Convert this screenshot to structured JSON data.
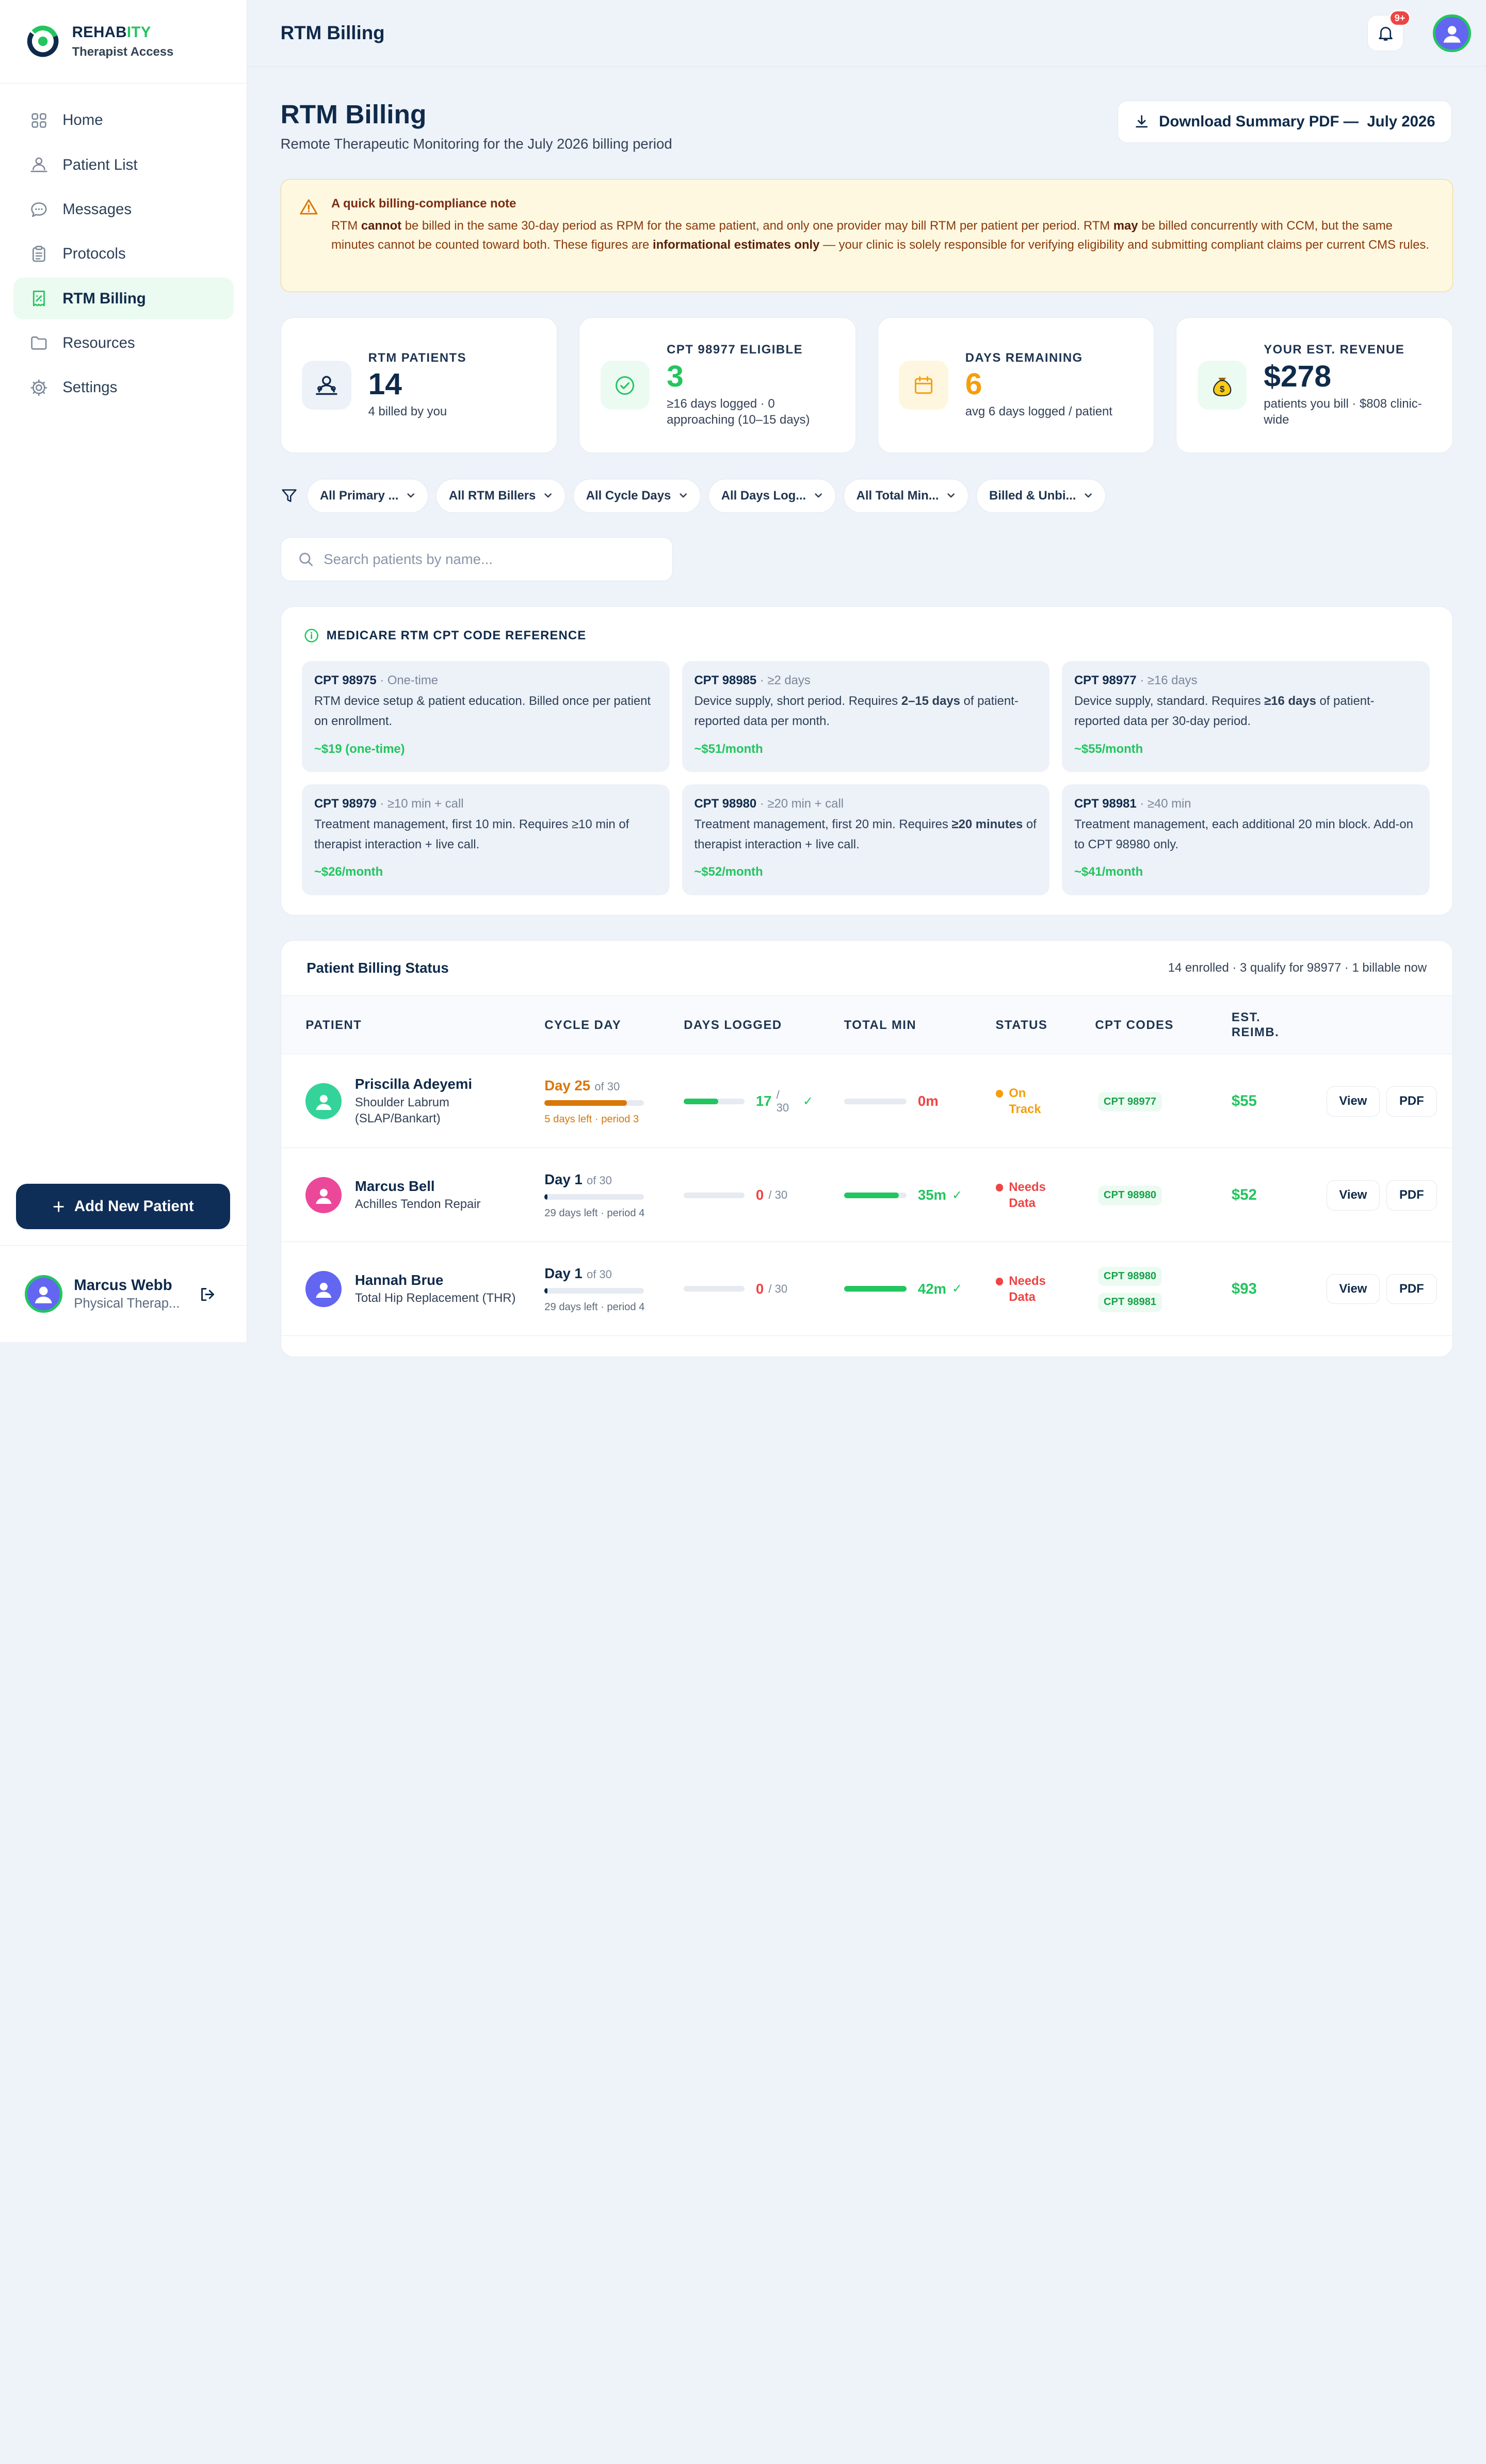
{
  "brand": {
    "name_main": "REHAB",
    "name_accent": "ITY",
    "subtitle": "Therapist Access"
  },
  "sidebar": {
    "items": [
      {
        "label": "Home",
        "icon": "grid-icon"
      },
      {
        "label": "Patient List",
        "icon": "users-icon"
      },
      {
        "label": "Messages",
        "icon": "chat-icon"
      },
      {
        "label": "Protocols",
        "icon": "clipboard-icon"
      },
      {
        "label": "RTM Billing",
        "icon": "receipt-icon",
        "active": true
      },
      {
        "label": "Resources",
        "icon": "folder-icon"
      },
      {
        "label": "Settings",
        "icon": "gear-icon"
      }
    ],
    "add_button": "Add New Patient",
    "user": {
      "name": "Marcus Webb",
      "role": "Physical Therap..."
    }
  },
  "topbar": {
    "title": "RTM Billing",
    "notifications": "9+"
  },
  "header": {
    "title": "RTM Billing",
    "subtitle": "Remote Therapeutic Monitoring for the July 2026 billing period",
    "download_label": "Download Summary PDF —  July 2026"
  },
  "note": {
    "title": "A quick billing-compliance note",
    "t1": "RTM ",
    "b1": "cannot",
    "t2": " be billed in the same 30-day period as RPM for the same patient, and only one provider may bill RTM per patient per period. RTM ",
    "b2": "may",
    "t3": " be billed concurrently with CCM, but the same minutes cannot be counted toward both. These figures are ",
    "b3": "informational estimates only",
    "t4": " — your clinic is solely responsible for verifying eligibility and submitting compliant claims per current CMS rules."
  },
  "stats": [
    {
      "label": "RTM Patients",
      "value": "14",
      "sub": "4 billed by you",
      "color": "#0f2a4a",
      "icon": "users-icon",
      "bg": "#edf1f8"
    },
    {
      "label": "CPT 98977 Eligible",
      "value": "3",
      "sub": "≥16 days logged · 0 approaching (10–15 days)",
      "color": "#22c55e",
      "icon": "check-circle-icon",
      "bg": "#ecfbf1"
    },
    {
      "label": "Days Remaining",
      "value": "6",
      "sub": "avg 6 days logged / patient",
      "color": "#f59e0b",
      "icon": "calendar-icon",
      "bg": "#fff6e0"
    },
    {
      "label": "Your Est. Revenue",
      "value": "$278",
      "sub": "patients you bill · $808 clinic-wide",
      "color": "#0f2a4a",
      "icon": "money-bag-icon",
      "bg": "#ecfbf1"
    }
  ],
  "filters": [
    "All Primary ...",
    "All RTM Billers",
    "All Cycle Days",
    "All Days Log...",
    "All Total Min...",
    "Billed & Unbi..."
  ],
  "search": {
    "placeholder": "Search patients by name..."
  },
  "reference": {
    "title": "MEDICARE RTM CPT CODE REFERENCE",
    "codes": [
      {
        "code": "CPT 98975",
        "meta": " · One-time",
        "desc": "RTM device setup & patient education. Billed once per patient on enrollment.",
        "price": "~$19 (one-time)"
      },
      {
        "code": "CPT 98985",
        "meta": " · ≥2 days",
        "desc_a": "Device supply, short period. Requires ",
        "desc_b": "2–15 days",
        "desc_c": " of patient-reported data per month.",
        "price": "~$51/month"
      },
      {
        "code": "CPT 98977",
        "meta": " · ≥16 days",
        "desc_a": "Device supply, standard. Requires ",
        "desc_b": "≥16 days",
        "desc_c": " of patient-reported data per 30-day period.",
        "price": "~$55/month"
      },
      {
        "code": "CPT 98979",
        "meta": " · ≥10 min + call",
        "desc": "Treatment management, first 10 min. Requires ≥10 min of therapist interaction + live call.",
        "price": "~$26/month"
      },
      {
        "code": "CPT 98980",
        "meta": " · ≥20 min + call",
        "desc_a": "Treatment management, first 20 min. Requires ",
        "desc_b": "≥20 minutes",
        "desc_c": " of therapist interaction + live call.",
        "price": "~$52/month"
      },
      {
        "code": "CPT 98981",
        "meta": " · ≥40 min",
        "desc": "Treatment management, each additional 20 min block. Add-on to CPT 98980 only.",
        "price": "~$41/month"
      }
    ]
  },
  "table": {
    "title": "Patient Billing Status",
    "meta": "14 enrolled · 3 qualify for 98977 · 1 billable now",
    "headers": {
      "patient": "PATIENT",
      "cycle": "CYCLE DAY",
      "days": "DAYS LOGGED",
      "total": "TOTAL MIN",
      "status": "STATUS",
      "cpt": "CPT CODES",
      "reimb_1": "EST.",
      "reimb_2": "REIMB."
    },
    "view_label": "View",
    "pdf_label": "PDF",
    "rows": [
      {
        "name": "Priscilla Adeyemi",
        "condition": "Shoulder Labrum (SLAP/Bankart)",
        "avatar": "#34d399",
        "cycle_day": "Day 25",
        "cycle_of": "of 30",
        "cycle_progress": 0.83,
        "cycle_color": "#d97706",
        "cycle_left": "5 days left · period 3",
        "days_logged": "17",
        "days_of": "/ 30",
        "days_progress": 0.57,
        "days_check": "✓",
        "total_min": "0m",
        "total_progress": 0,
        "total_color": "#ef4444",
        "total_check": "",
        "status_1": "On",
        "status_2": "Track",
        "status_color": "#f59e0b",
        "cpts": [
          "CPT 98977"
        ],
        "reimb": "$55"
      },
      {
        "name": "Marcus Bell",
        "condition": "Achilles Tendon Repair",
        "avatar": "#ec4899",
        "cycle_day": "Day 1",
        "cycle_of": "of 30",
        "cycle_progress": 0.03,
        "cycle_color": "#0f2a4a",
        "cycle_left": "29 days left · period 4",
        "days_logged": "0",
        "days_of": "/ 30",
        "days_progress": 0,
        "days_check": "",
        "total_min": "35m",
        "total_progress": 0.88,
        "total_color": "#22c55e",
        "total_check": "✓",
        "status_1": "Needs",
        "status_2": "Data",
        "status_color": "#ef4444",
        "cpts": [
          "CPT 98980"
        ],
        "reimb": "$52"
      },
      {
        "name": "Hannah Brue",
        "condition": "Total Hip Replacement (THR)",
        "avatar": "#6366f1",
        "cycle_day": "Day 1",
        "cycle_of": "of 30",
        "cycle_progress": 0.03,
        "cycle_color": "#0f2a4a",
        "cycle_left": "29 days left · period 4",
        "days_logged": "0",
        "days_of": "/ 30",
        "days_progress": 0,
        "days_check": "",
        "total_min": "42m",
        "total_progress": 1.0,
        "total_color": "#22c55e",
        "total_check": "✓",
        "status_1": "Needs",
        "status_2": "Data",
        "status_color": "#ef4444",
        "cpts": [
          "CPT 98980",
          "CPT 98981"
        ],
        "reimb": "$93"
      }
    ]
  }
}
